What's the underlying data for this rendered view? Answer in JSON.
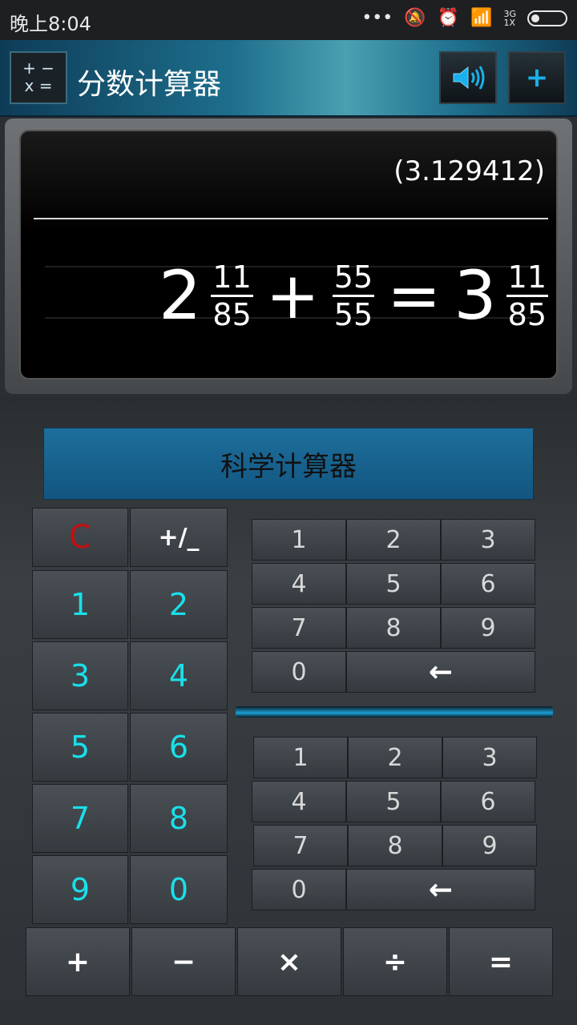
{
  "status": {
    "time": "晚上8:04",
    "network": "3G",
    "network_sub": "1X"
  },
  "header": {
    "title": "分数计算器",
    "icon_text_top": "+ −",
    "icon_text_bottom": "x ="
  },
  "display": {
    "decimal": "(3.129412)",
    "operand1": {
      "whole": "2",
      "num": "11",
      "den": "85"
    },
    "operator": "+",
    "operand2": {
      "num": "55",
      "den": "55"
    },
    "equals": "=",
    "result": {
      "whole": "3",
      "num": "11",
      "den": "85"
    }
  },
  "scientific_button": "科学计算器",
  "left_pad": {
    "clear": "C",
    "sign": "+/_",
    "digits": [
      "1",
      "2",
      "3",
      "4",
      "5",
      "6",
      "7",
      "8",
      "9",
      "0"
    ]
  },
  "numerator_pad": {
    "digits": [
      "1",
      "2",
      "3",
      "4",
      "5",
      "6",
      "7",
      "8",
      "9",
      "0"
    ],
    "backspace": "←"
  },
  "denominator_pad": {
    "digits": [
      "1",
      "2",
      "3",
      "4",
      "5",
      "6",
      "7",
      "8",
      "9",
      "0"
    ],
    "backspace": "←"
  },
  "operators": [
    "+",
    "−",
    "×",
    "÷",
    "="
  ],
  "colors": {
    "accent": "#19b0ec",
    "left_digit": "#19e0ea",
    "clear": "#c21010"
  }
}
